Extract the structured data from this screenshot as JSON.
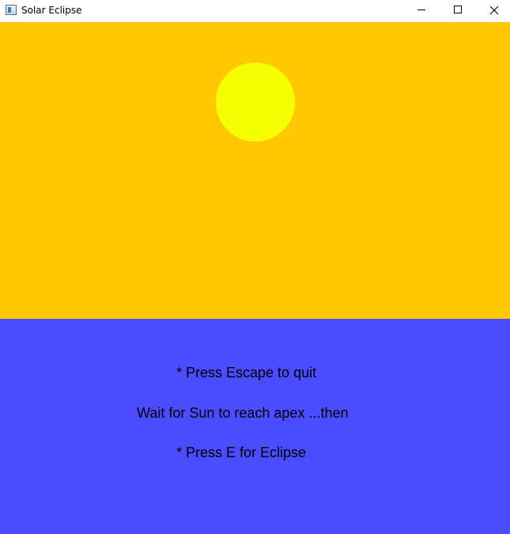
{
  "window": {
    "title": "Solar Eclipse",
    "icon": "app-window-icon",
    "controls": {
      "minimize": "minimize-icon",
      "maximize": "maximize-icon",
      "close": "close-icon"
    }
  },
  "scene": {
    "sky_color": "#ffc800",
    "sun_color": "#f5ff00",
    "ground_color": "#4b4bff"
  },
  "instructions": {
    "line1": "* Press Escape to quit",
    "line2": "Wait for Sun to reach apex ...then",
    "line3": "* Press E for Eclipse"
  }
}
